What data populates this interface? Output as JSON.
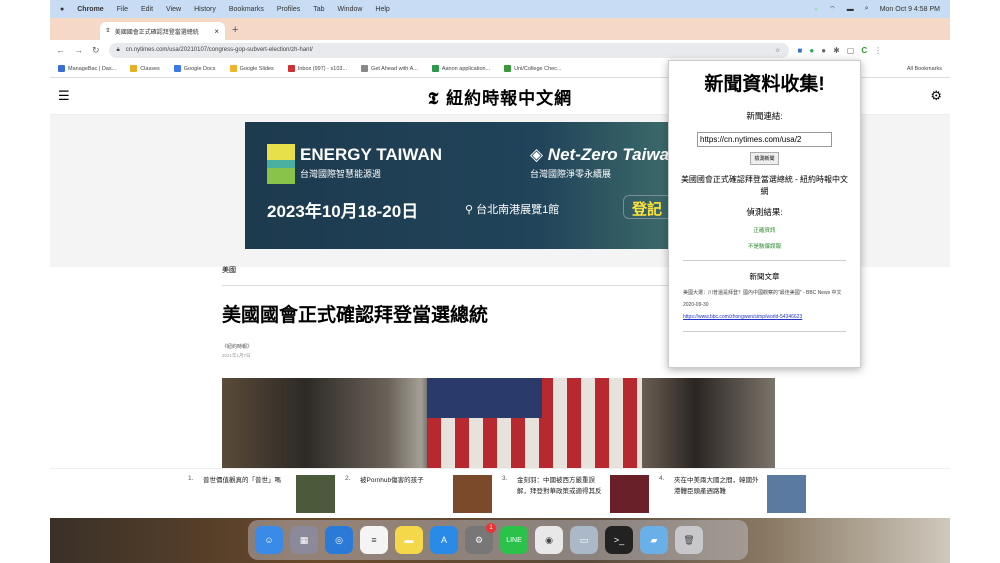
{
  "menubar": {
    "apple": "",
    "items": [
      "Chrome",
      "File",
      "Edit",
      "View",
      "History",
      "Bookmarks",
      "Profiles",
      "Tab",
      "Window",
      "Help"
    ],
    "clock": "Mon Oct 9  4:58 PM"
  },
  "tab": {
    "title": "美國國會正式確認拜登當選總統",
    "close": "×",
    "new": "+"
  },
  "toolbar": {
    "back": "←",
    "forward": "→",
    "reload": "↻",
    "url": "cn.nytimes.com/usa/20210107/congress-gop-subvert-election/zh-hant/",
    "menu": "⋮"
  },
  "bookmarks": {
    "items": [
      "ManageBac | Das...",
      "Classes",
      "Google Docs",
      "Google Slides",
      "Inbox (997) - s103...",
      "Get Ahead with A...",
      "Aanon application...",
      "Uni/College Chec..."
    ],
    "colors": [
      "#3a6fd0",
      "#e8b020",
      "#3a7ae8",
      "#f0b428",
      "#d03030",
      "#888888",
      "#2a9a4a",
      "#3a9a3a"
    ],
    "all": "All Bookmarks"
  },
  "nyt": {
    "menu_icon": "☰",
    "logo": "紐約時報中文網",
    "settings_icon": "⚙"
  },
  "ad": {
    "brand1": "ENERGY TAIWAN",
    "brand1_sub": "台灣國際智慧能源週",
    "brand2": "Net-Zero Taiwan",
    "brand2_sub": "台灣國際淨零永續展",
    "date": "2023年10月18-20日",
    "location": "台北南港展覽1館",
    "cta": "登記"
  },
  "article": {
    "section": "美國",
    "headline": "美國國會正式確認拜登當選總統",
    "byline": "《紐約時報》",
    "date": "2021年1月7日"
  },
  "recommended": [
    {
      "num": "1.",
      "title": "普世價值觀真的「普世」嗎",
      "thumb": "#4a5a3a"
    },
    {
      "num": "2.",
      "title": "被Pornhub傷害的孩子",
      "thumb": "#7a4a2a"
    },
    {
      "num": "3.",
      "title": "金刻羽：中國被西方嚴重誤解，拜登對華政策或適得其反",
      "thumb": "#6a2028"
    },
    {
      "num": "4.",
      "title": "夾在中美兩大國之間，韓國外港體臣頭產週路難",
      "thumb": "#5a7aa0"
    }
  ],
  "popup": {
    "title": "新聞資料收集!",
    "link_label": "新聞連結:",
    "url_value": "https://cn.nytimes.com/usa/2",
    "check_button": "檢測新聞",
    "page_title": "美國國會正式確認拜登當選總統 - 紐約時報中文網",
    "result_label": "偵測結果:",
    "result1": "正確資訊",
    "result2": "不是駭爆誤報",
    "articles_label": "新聞文章",
    "article_title": "美國大選：川普還是拜登？國內中國觀察的\"最佳美國\" - BBC News 中文",
    "article_date": "2020-09-30",
    "article_link": "https://www.bbc.com/zhongwen/simp/world-54346623"
  },
  "dock": [
    {
      "name": "finder",
      "color": "#3a8ae8",
      "g": "☺"
    },
    {
      "name": "launchpad",
      "color": "#8a8a9a",
      "g": "▦"
    },
    {
      "name": "safari",
      "color": "#2a7ad8",
      "g": "◎"
    },
    {
      "name": "reminders",
      "color": "#f4f4f4",
      "g": "≡"
    },
    {
      "name": "notes",
      "color": "#f4d84a",
      "g": "▬"
    },
    {
      "name": "app-store",
      "color": "#2a8ae8",
      "g": "A"
    },
    {
      "name": "system-settings",
      "color": "#777",
      "g": "⚙",
      "badge": "1"
    },
    {
      "name": "line",
      "color": "#2ac24a",
      "g": "LINE"
    },
    {
      "name": "chrome",
      "color": "#e8e8e8",
      "g": "◉"
    },
    {
      "name": "preview",
      "color": "#aab8c8",
      "g": "▭"
    },
    {
      "name": "terminal",
      "color": "#222",
      "g": ">_"
    },
    {
      "name": "folder",
      "color": "#6ab0e8",
      "g": "▰"
    },
    {
      "name": "trash",
      "color": "#c8c8cc",
      "g": "🗑"
    }
  ]
}
